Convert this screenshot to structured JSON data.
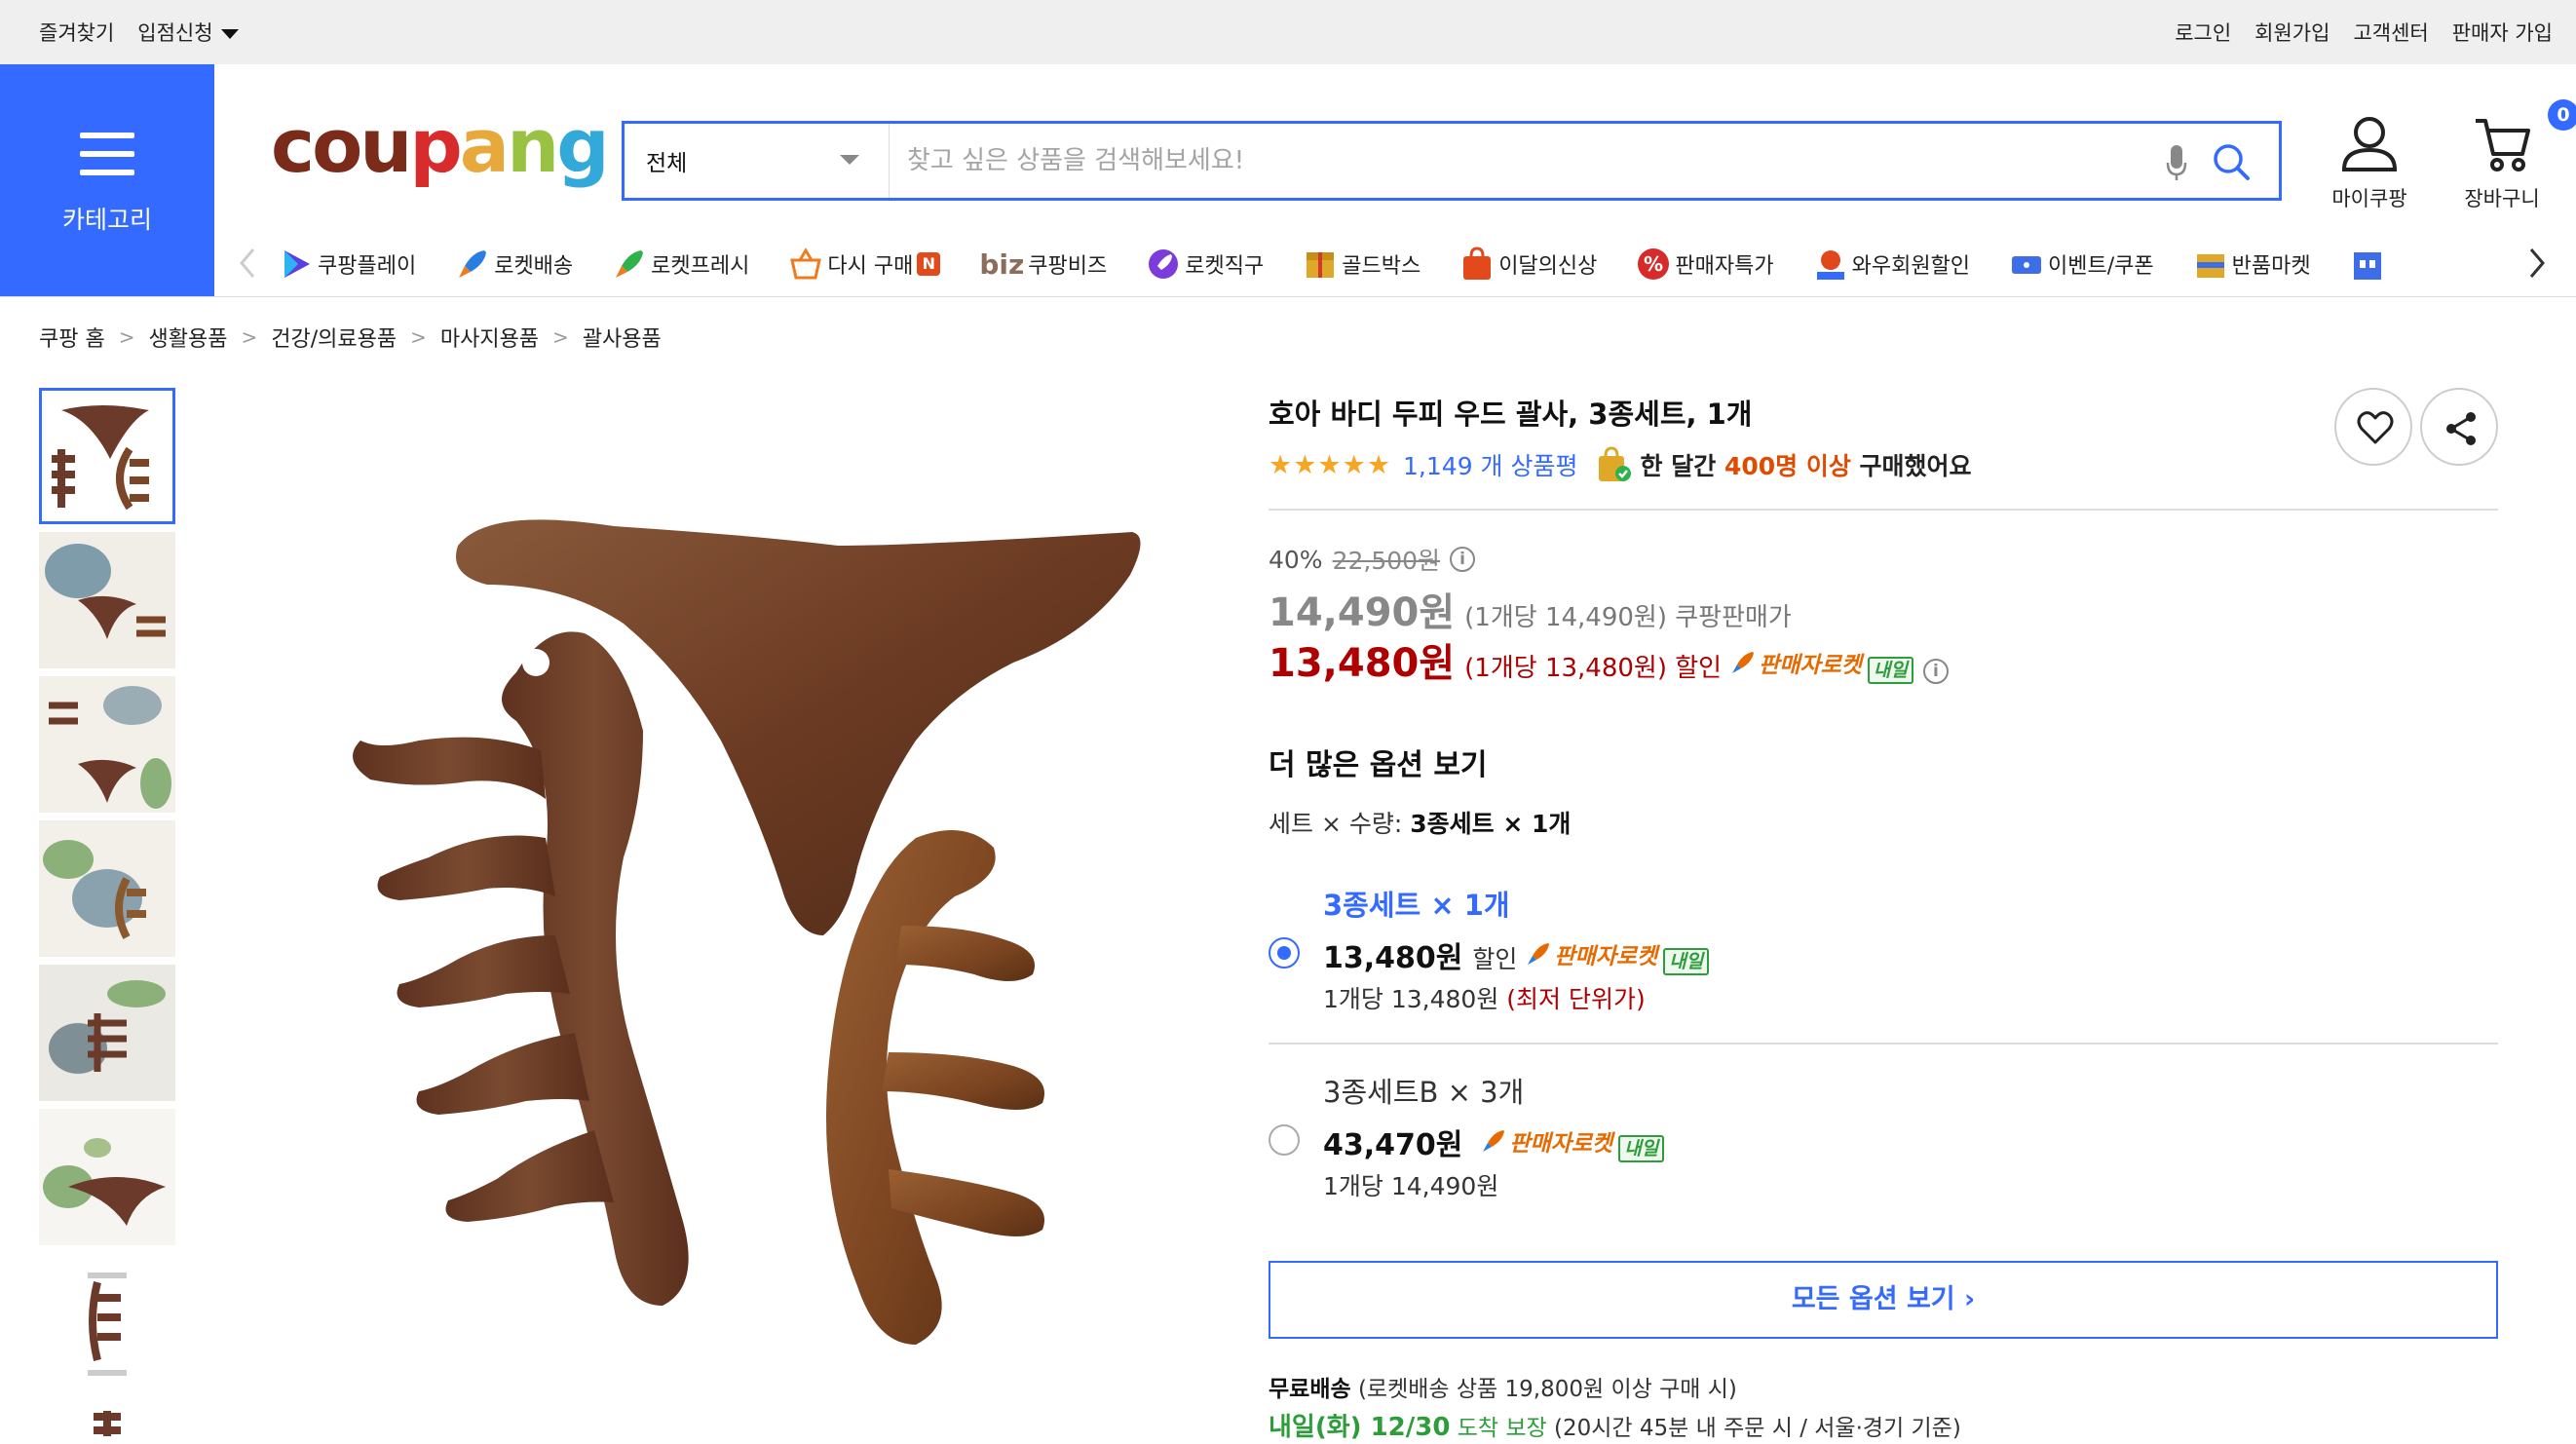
{
  "topbar": {
    "left": [
      "즐겨찾기",
      "입점신청"
    ],
    "right": [
      "로그인",
      "회원가입",
      "고객센터",
      "판매자 가입"
    ]
  },
  "header": {
    "category_label": "카테고리",
    "logo": [
      "c",
      "o",
      "u",
      "p",
      "a",
      "n",
      "g"
    ],
    "search_category": "전체",
    "search_placeholder": "찾고 싶은 상품을 검색해보세요!",
    "mycoupang_label": "마이쿠팡",
    "cart_label": "장바구니",
    "cart_count": "0"
  },
  "nav": [
    {
      "label": "쿠팡플레이",
      "icon": "play-icon",
      "color": "#5b3fe0"
    },
    {
      "label": "로켓배송",
      "icon": "rocket-icon",
      "color": "#2a7de1"
    },
    {
      "label": "로켓프레시",
      "icon": "rocket-fresh-icon",
      "color": "#2fb24c"
    },
    {
      "label": "다시 구매",
      "icon": "basket-icon",
      "color": "#f07b1c"
    },
    {
      "label": "쿠팡비즈",
      "icon": "biz-icon",
      "color": "#8a6d5a"
    },
    {
      "label": "로켓직구",
      "icon": "global-rocket-icon",
      "color": "#7d3bd9"
    },
    {
      "label": "골드박스",
      "icon": "goldbox-icon",
      "color": "#e0a829"
    },
    {
      "label": "이달의신상",
      "icon": "new-bag-icon",
      "color": "#e24a1b"
    },
    {
      "label": "판매자특가",
      "icon": "percent-icon",
      "color": "#d72b2b"
    },
    {
      "label": "와우회원할인",
      "icon": "wow-icon",
      "color": "#e2461b"
    },
    {
      "label": "이벤트/쿠폰",
      "icon": "coupon-icon",
      "color": "#3d6ee8"
    },
    {
      "label": "반품마켓",
      "icon": "sale-box-icon",
      "color": "#e0a829"
    }
  ],
  "nav_new_badge": "N",
  "nav_biz_prefix": "biz",
  "breadcrumb": [
    "쿠팡 홈",
    "생활용품",
    "건강/의료용품",
    "마사지용품",
    "괄사용품"
  ],
  "product": {
    "title": "호아 바디 두피 우드 괄사, 3종세트, 1개",
    "stars": "★★★★★",
    "review_count": "1,149 개 상품평",
    "bought_prefix": "한 달간",
    "bought_highlight": "400명 이상",
    "bought_suffix": "구매했어요",
    "discount": "40%",
    "original_price": "22,500원",
    "coupang_price": "14,490원",
    "coupang_price_unit": "(1개당 14,490원) 쿠팡판매가",
    "sale_price": "13,480원",
    "sale_price_unit": "(1개당 13,480원) 할인",
    "rocket_label": "판매자로켓",
    "nextday_label": "내일"
  },
  "options": {
    "heading": "더 많은 옵션 보기",
    "selection_prefix": "세트 × 수량:",
    "selection_value": "3종세트 × 1개",
    "items": [
      {
        "name": "3종세트 × 1개",
        "price": "13,480원",
        "price_note": "할인",
        "unit": "1개당 13,480원",
        "unit_note": "(최저 단위가)",
        "selected": true
      },
      {
        "name": "3종세트B × 3개",
        "price": "43,470원",
        "price_note": "",
        "unit": "1개당 14,490원",
        "unit_note": "",
        "selected": false
      }
    ],
    "all_options": "모든 옵션 보기 ›"
  },
  "shipping": {
    "free": "무료배송",
    "free_note": "(로켓배송 상품 19,800원 이상 구매 시)",
    "arrival": "내일(화) 12/30",
    "arrival_note": "도착 보장",
    "cutoff": "(20시간 45분 내 주문 시 / 서울·경기 기준)"
  },
  "colors": {
    "accent": "#346aff",
    "sale": "#ae0000",
    "rocket": "#e76a00",
    "nextday": "#2d9d3a"
  }
}
